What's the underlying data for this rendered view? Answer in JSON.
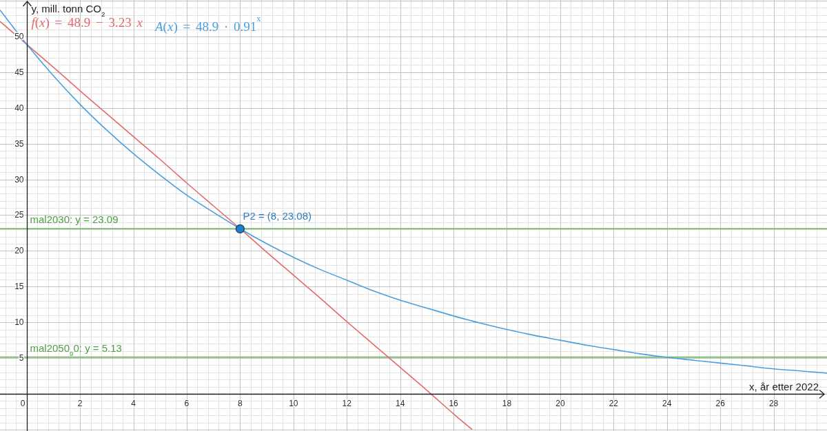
{
  "chart_data": {
    "type": "line",
    "xlabel": "x, år etter 2022",
    "ylabel": "y, mill. tonn CO$_{2}$",
    "xlim": [
      -1,
      30
    ],
    "ylim": [
      -5.2,
      55.1
    ],
    "xticks": [
      0,
      2,
      4,
      6,
      8,
      10,
      12,
      14,
      16,
      18,
      20,
      22,
      24,
      26,
      28
    ],
    "yticks": [
      5,
      10,
      15,
      20,
      25,
      30,
      35,
      40,
      45,
      50
    ],
    "grid": true,
    "x": [
      -1,
      0,
      1,
      2,
      3,
      4,
      5,
      6,
      7,
      8,
      9,
      10,
      11,
      12,
      13,
      14,
      15,
      16,
      16.7,
      17,
      18,
      19,
      20,
      21,
      22,
      23,
      24,
      25,
      26,
      27,
      28,
      29,
      30
    ],
    "series": [
      {
        "name": "*f*(*x*) = 48.9 − 3.23 *x*",
        "color": "#e46a6a",
        "values": [
          52.1,
          48.9,
          45.7,
          42.4,
          39.2,
          36,
          32.8,
          29.5,
          26.3,
          23.1,
          19.8,
          16.6,
          13.4,
          10.1,
          6.9,
          3.7,
          0.5,
          -2.8,
          -5,
          null,
          null,
          null,
          null,
          null,
          null,
          null,
          null,
          null,
          null,
          null,
          null,
          null,
          null
        ]
      },
      {
        "name": "*A*(*x*) = 48.9 · 0.91$^{x}$",
        "color": "#4a9fdc",
        "values": [
          53.7,
          48.9,
          44.5,
          40.5,
          36.9,
          33.6,
          30.6,
          27.8,
          25.4,
          23.1,
          21,
          19.1,
          17.4,
          15.9,
          14.4,
          13.1,
          12,
          10.9,
          10.2,
          9.9,
          9,
          8.2,
          7.5,
          6.8,
          6.2,
          5.6,
          5.1,
          4.7,
          4.3,
          3.9,
          3.5,
          3.2,
          2.9
        ]
      }
    ],
    "ref_lines": [
      {
        "axis": "y",
        "value": 23.09,
        "label": "mal2030: y = 23.09",
        "color": "#7dbb70"
      },
      {
        "axis": "y",
        "value": 5.13,
        "label": "mal2050$_{9}$0: y = 5.13",
        "color": "#7dbb70"
      }
    ],
    "annotations": [
      {
        "x": 8,
        "y": 23.08,
        "text": "P2 = (8, 23.08)"
      }
    ]
  }
}
